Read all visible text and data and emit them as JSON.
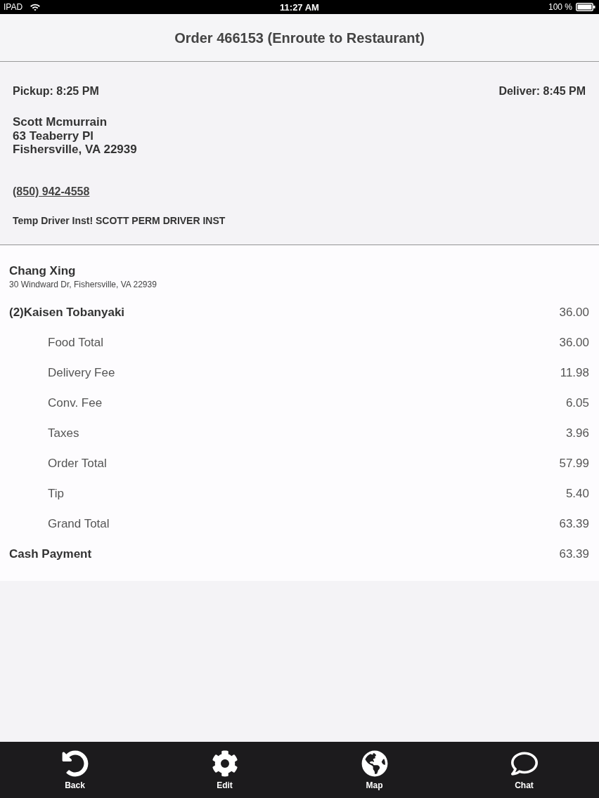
{
  "status_bar": {
    "device": "IPAD",
    "time": "11:27 AM",
    "battery": "100 %"
  },
  "header": {
    "title": "Order 466153 (Enroute to Restaurant)"
  },
  "delivery": {
    "pickup": "Pickup: 8:25 PM",
    "deliver": "Deliver: 8:45 PM",
    "customer_name": "Scott Mcmurrain",
    "address_lines": [
      "63 Teaberry Pl",
      "Fishersville, VA 22939"
    ],
    "phone": "(850) 942-4558",
    "instructions": "Temp Driver Inst! SCOTT PERM DRIVER INST"
  },
  "restaurant": {
    "name": "Chang Xing",
    "address": "30 Windward Dr, Fishersville, VA 22939"
  },
  "lines": [
    {
      "kind": "item",
      "label": "(2)Kaisen Tobanyaki",
      "amount": "36.00"
    },
    {
      "kind": "subtotal",
      "label": "Food Total",
      "amount": "36.00"
    },
    {
      "kind": "subtotal",
      "label": "Delivery Fee",
      "amount": "11.98"
    },
    {
      "kind": "subtotal",
      "label": "Conv. Fee",
      "amount": "6.05"
    },
    {
      "kind": "subtotal",
      "label": "Taxes",
      "amount": "3.96"
    },
    {
      "kind": "subtotal",
      "label": "Order Total",
      "amount": "57.99"
    },
    {
      "kind": "subtotal",
      "label": "Tip",
      "amount": "5.40"
    },
    {
      "kind": "subtotal",
      "label": "Grand Total",
      "amount": "63.39"
    },
    {
      "kind": "item",
      "label": "Cash Payment",
      "amount": "63.39"
    }
  ],
  "tab_bar": [
    {
      "label": "Back"
    },
    {
      "label": "Edit"
    },
    {
      "label": "Map"
    },
    {
      "label": "Chat"
    }
  ]
}
